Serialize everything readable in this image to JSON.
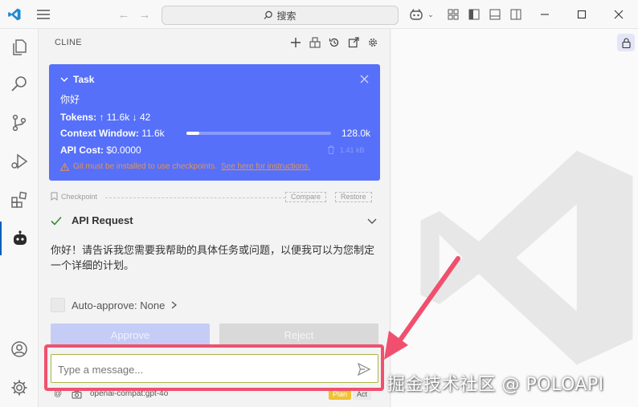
{
  "titlebar": {
    "search_label": "搜索"
  },
  "panel": {
    "title": "CLINE"
  },
  "task": {
    "header": "Task",
    "prompt": "你好",
    "tokens_label": "Tokens:",
    "tokens_in": "↑ 11.6k",
    "tokens_out": "↓ 42",
    "context_label": "Context Window:",
    "context_used": "11.6k",
    "context_total": "128.0k",
    "context_fraction": 0.09,
    "api_cost_label": "API Cost:",
    "api_cost": "$0.0000",
    "size": "1.41 kB",
    "warning_text": "Git must be installed to use checkpoints.",
    "warning_link": "See here for instructions."
  },
  "checkpoint": {
    "label": "Checkpoint",
    "compare": "Compare",
    "restore": "Restore"
  },
  "api_request": {
    "label": "API Request"
  },
  "answer": {
    "text": "你好！请告诉我您需要我帮助的具体任务或问题，以便我可以为您制定一个详细的计划。"
  },
  "auto_approve": {
    "label": "Auto-approve: None"
  },
  "buttons": {
    "approve": "Approve",
    "reject": "Reject"
  },
  "input": {
    "placeholder": "Type a message..."
  },
  "footer": {
    "model": "openai-compat:gpt-4o",
    "plan": "Plan",
    "act": "Act"
  },
  "watermark": "掘金技术社区 @ POLOAPI",
  "colors": {
    "task_card": "#5670f9",
    "accent": "#005fb8",
    "highlight": "#f0506e",
    "plan_pill": "#f1c232"
  }
}
